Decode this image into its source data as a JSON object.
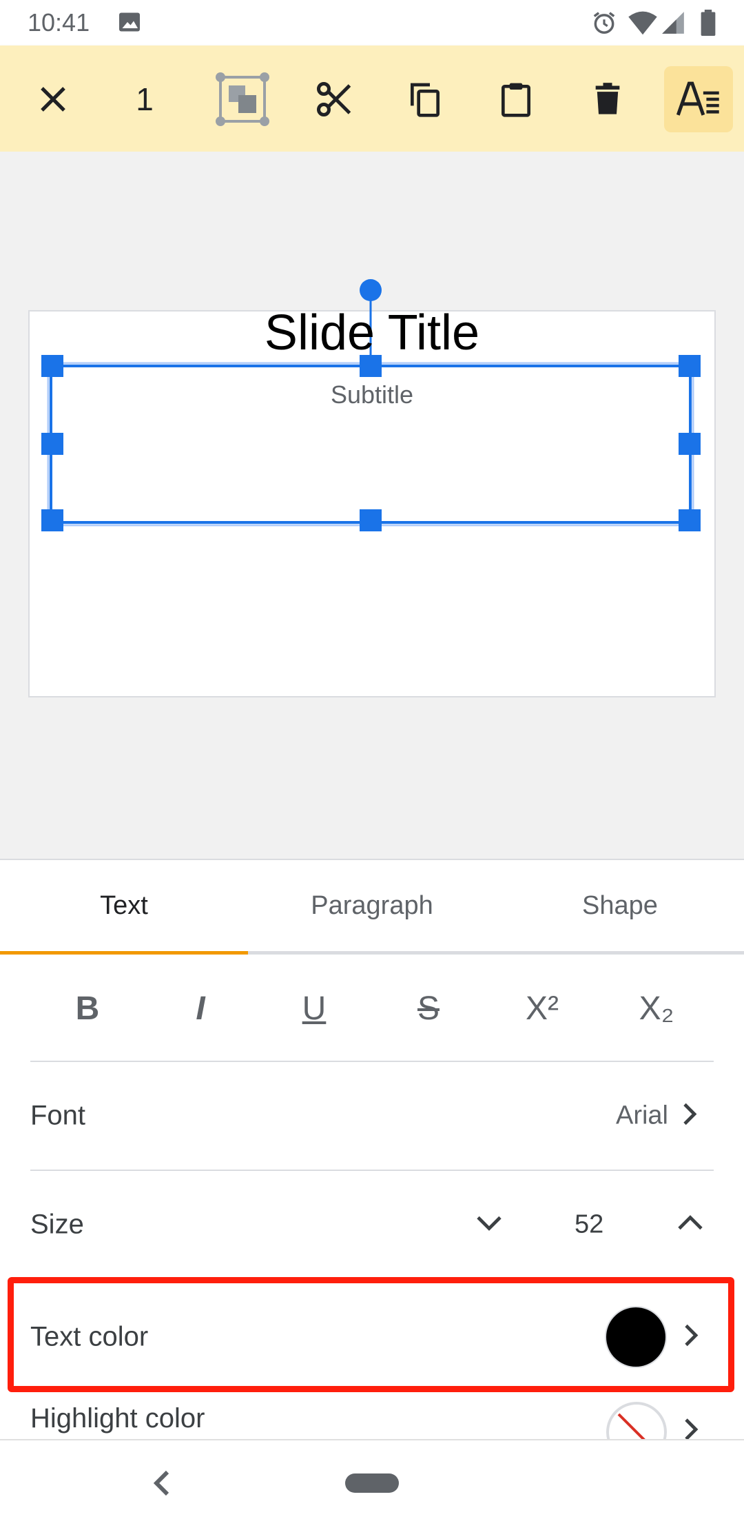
{
  "status_bar": {
    "time": "10:41",
    "icons": [
      "image-icon",
      "alarm-icon",
      "wifi-icon",
      "signal-icon",
      "battery-icon"
    ]
  },
  "toolbar": {
    "selection_count": "1",
    "buttons": [
      "close-icon",
      "arrange-icon",
      "cut-icon",
      "copy-icon",
      "paste-icon",
      "delete-icon",
      "format-options-icon"
    ]
  },
  "slide": {
    "title": "Slide Title",
    "subtitle": "Subtitle"
  },
  "panel": {
    "tabs": [
      {
        "label": "Text",
        "active": true
      },
      {
        "label": "Paragraph",
        "active": false
      },
      {
        "label": "Shape",
        "active": false
      }
    ],
    "format_buttons": [
      "B",
      "I",
      "U",
      "S",
      "X²",
      "X₂"
    ],
    "font": {
      "label": "Font",
      "value": "Arial"
    },
    "size": {
      "label": "Size",
      "value": "52"
    },
    "text_color": {
      "label": "Text color",
      "swatch": "#000000"
    },
    "highlight_color": {
      "label": "Highlight color"
    }
  },
  "colors": {
    "toolbar_bg": "#fdefbd",
    "accent": "#f29900",
    "selection": "#1a73e8",
    "callout": "#ff1e0c"
  }
}
